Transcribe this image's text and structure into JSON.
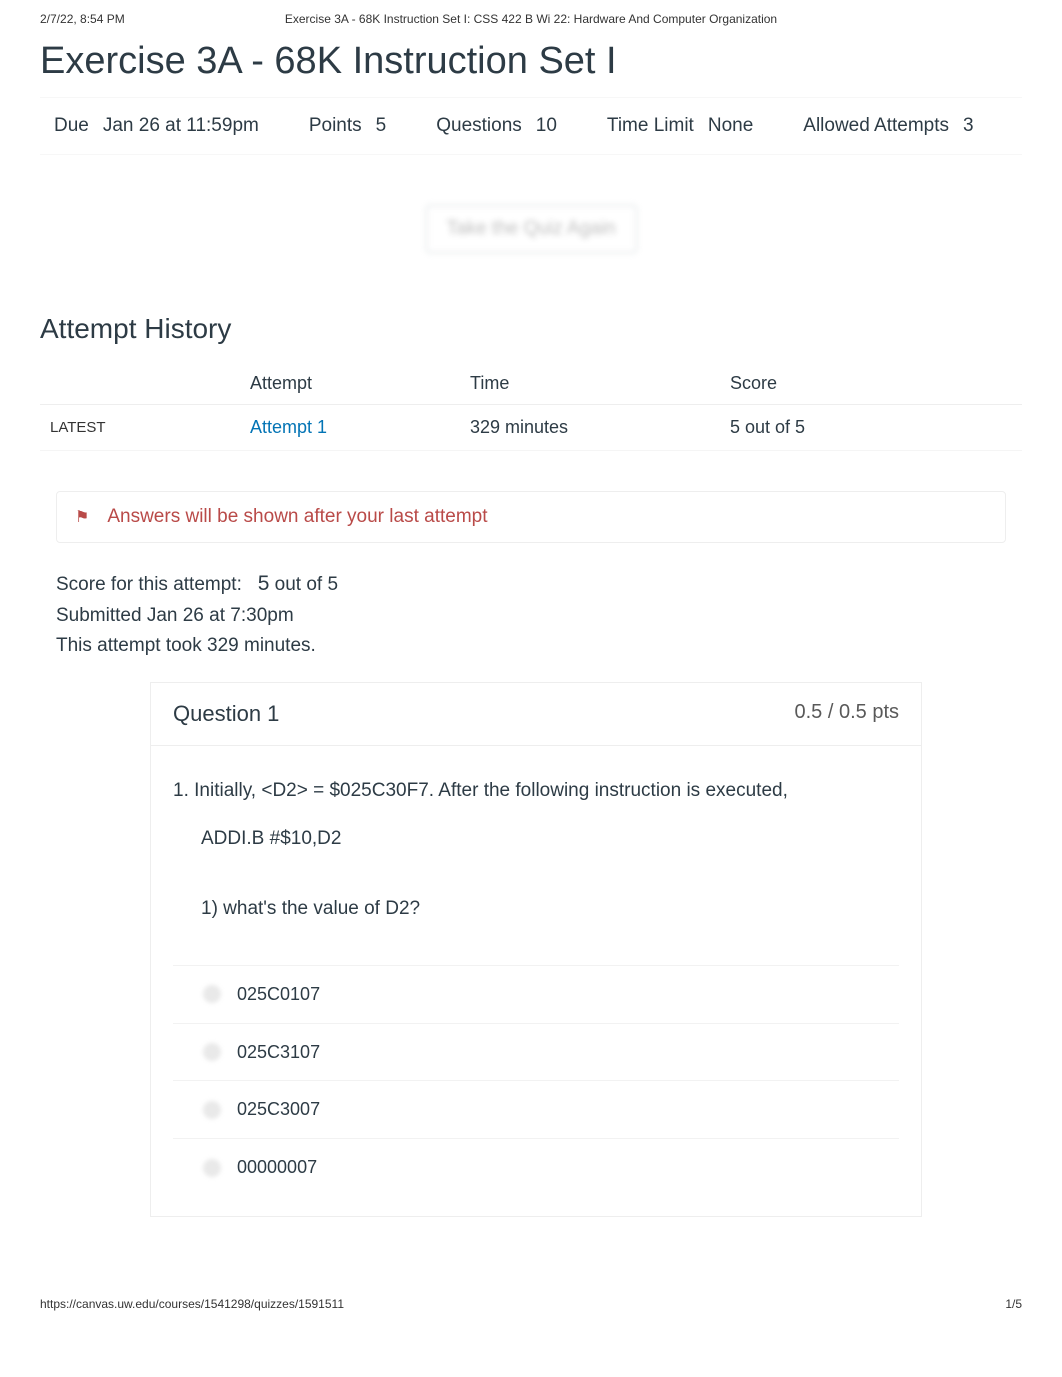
{
  "print": {
    "datetime": "2/7/22, 8:54 PM",
    "doc_title": "Exercise 3A - 68K Instruction Set I: CSS 422 B Wi 22: Hardware And Computer Organization"
  },
  "page_title": "Exercise 3A - 68K Instruction Set I",
  "meta": {
    "due_label": "Due",
    "due_value": "Jan 26 at 11:59pm",
    "points_label": "Points",
    "points_value": "5",
    "questions_label": "Questions",
    "questions_value": "10",
    "timelimit_label": "Time Limit",
    "timelimit_value": "None",
    "attempts_label": "Allowed Attempts",
    "attempts_value": "3"
  },
  "take_again_label": "Take the Quiz Again",
  "history_title": "Attempt History",
  "history": {
    "headers": {
      "blank": "",
      "attempt": "Attempt",
      "time": "Time",
      "score": "Score"
    },
    "rows": [
      {
        "tag": "LATEST",
        "attempt": "Attempt 1",
        "time": "329 minutes",
        "score": "5 out of 5"
      }
    ]
  },
  "notice": {
    "flag_icon": "⚑",
    "text": "Answers will be shown after your last attempt"
  },
  "score_info": {
    "line1_prefix": "Score for this attempt:",
    "line1_score": "5",
    "line1_suffix": "out of 5",
    "line2": "Submitted Jan 26 at 7:30pm",
    "line3": "This attempt took 329 minutes."
  },
  "question": {
    "title": "Question 1",
    "points": "0.5 / 0.5 pts",
    "prompt_line1": "1. Initially, <D2> = $025C30F7. After the following instruction is executed,",
    "prompt_code": "ADDI.B #$10,D2",
    "prompt_line2": "1) what's the value of D2?",
    "answers": [
      "025C0107",
      "025C3107",
      "025C3007",
      "00000007"
    ]
  },
  "footer": {
    "url": "https://canvas.uw.edu/courses/1541298/quizzes/1591511",
    "page": "1/5"
  }
}
